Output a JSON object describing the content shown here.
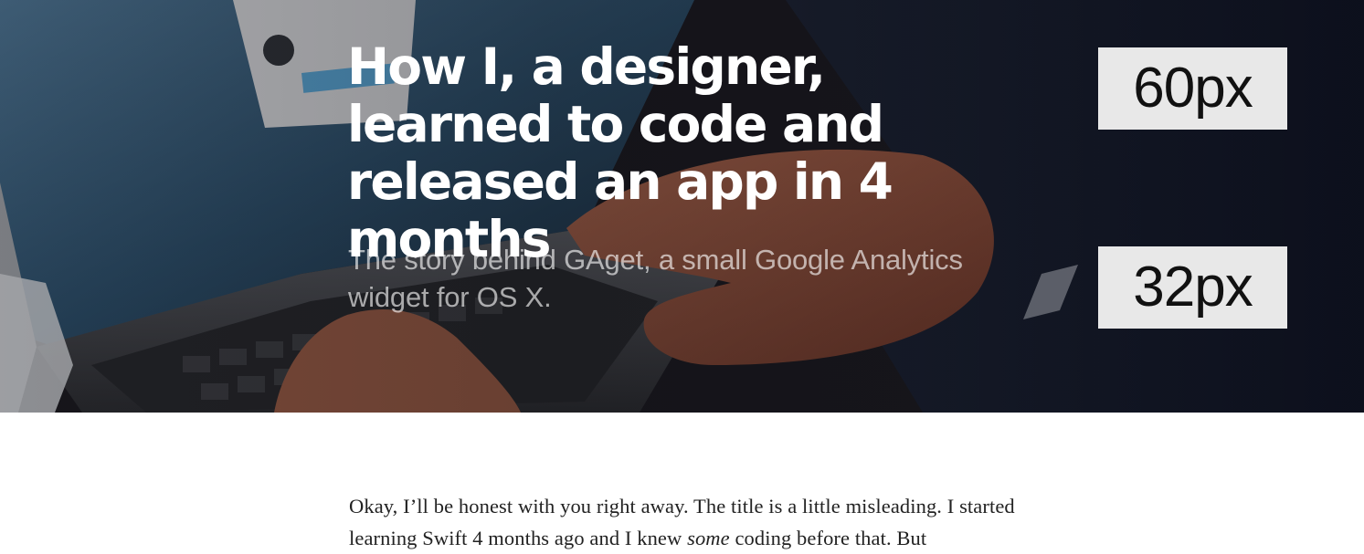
{
  "hero": {
    "title": "How I, a designer, learned to code and released an app in 4 months",
    "subtitle": "The story behind GAget, a small Google Analytics widget for OS X.",
    "badges": {
      "title_size": "60px",
      "subtitle_size": "32px"
    },
    "image": "laptop-hands-typing-photo"
  },
  "article": {
    "paragraph_1": {
      "before_emphasis": "Okay, I’ll be honest with you right away. The title is a little misleading. I started learning Swift 4 months ago and I knew ",
      "emphasis": "some",
      "after_emphasis": " coding before that. But"
    }
  },
  "colors": {
    "hero_background": "#17161c",
    "badge_background": "#e8e8e8",
    "title_text": "#ffffff",
    "body_text": "#222222"
  }
}
